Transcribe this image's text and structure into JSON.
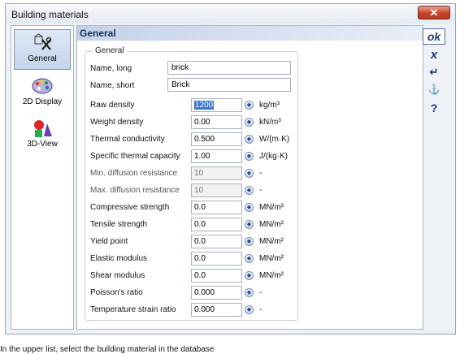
{
  "window": {
    "title": "Building materials",
    "close_label": "✕"
  },
  "sidebar": {
    "items": [
      {
        "label": "General",
        "active": true
      },
      {
        "label": "2D Display",
        "active": false
      },
      {
        "label": "3D-View",
        "active": false
      }
    ]
  },
  "content": {
    "header_title": "General",
    "group_title": "General",
    "name_long": {
      "label": "Name, long",
      "value": "brick"
    },
    "name_short": {
      "label": "Name, short",
      "value": "Brick"
    },
    "properties": [
      {
        "label": "Raw density",
        "value": "1200",
        "unit": "kg/m³"
      },
      {
        "label": "Weight density",
        "value": "0.00",
        "unit": "kN/m³"
      },
      {
        "label": "Thermal conductivity",
        "value": "0.500",
        "unit": "W/(m·K)"
      },
      {
        "label": "Specific thermal capacity",
        "value": "1.00",
        "unit": "J/(kg·K)"
      },
      {
        "label": "Min. diffusion resistance",
        "value": "10",
        "unit": "-"
      },
      {
        "label": "Max. diffusion resistance",
        "value": "10",
        "unit": "-"
      },
      {
        "label": "Compressive strength",
        "value": "0.0",
        "unit": "MN/m²"
      },
      {
        "label": "Tensile strength",
        "value": "0.0",
        "unit": "MN/m²"
      },
      {
        "label": "Yield point",
        "value": "0.0",
        "unit": "MN/m²"
      },
      {
        "label": "Elastic modulus",
        "value": "0.0",
        "unit": "MN/m²"
      },
      {
        "label": "Shear modulus",
        "value": "0.0",
        "unit": "MN/m²"
      },
      {
        "label": "Poisson's ratio",
        "value": "0.000",
        "unit": "-"
      },
      {
        "label": "Temperature strain ratio",
        "value": "0.000",
        "unit": "-"
      }
    ]
  },
  "toolbar": {
    "ok_label": "ok",
    "cancel_label": "x",
    "enter_label": "↵",
    "anchor_label": "⚓",
    "help_label": "?"
  },
  "status_text": "In the upper list, select the building material in the database"
}
